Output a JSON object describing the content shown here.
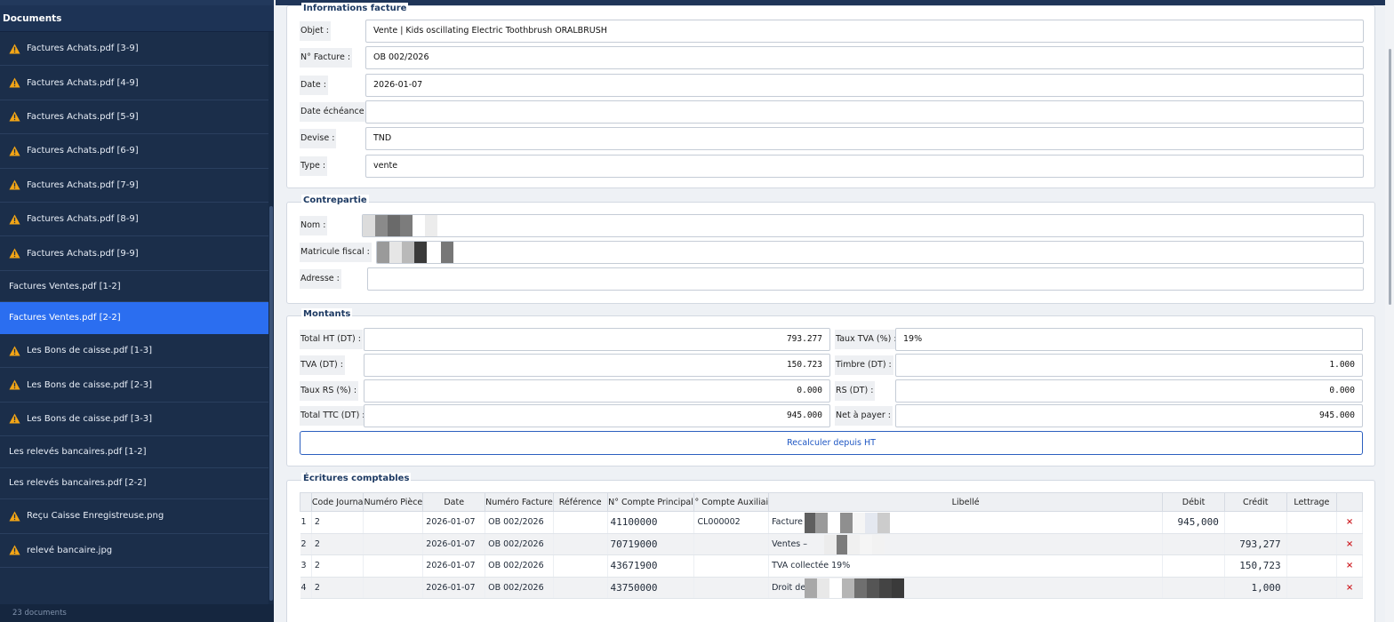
{
  "sidebar": {
    "title": "Documents",
    "items": [
      {
        "label": "Factures Achats.pdf [3-9]",
        "warning": true
      },
      {
        "label": "Factures Achats.pdf [4-9]",
        "warning": true
      },
      {
        "label": "Factures Achats.pdf [5-9]",
        "warning": true
      },
      {
        "label": "Factures Achats.pdf [6-9]",
        "warning": true
      },
      {
        "label": "Factures Achats.pdf [7-9]",
        "warning": true
      },
      {
        "label": "Factures Achats.pdf [8-9]",
        "warning": true
      },
      {
        "label": "Factures Achats.pdf [9-9]",
        "warning": true
      },
      {
        "label": "Factures Ventes.pdf [1-2]",
        "warning": false
      },
      {
        "label": "Factures Ventes.pdf [2-2]",
        "warning": false,
        "selected": true
      },
      {
        "label": "Les Bons de caisse.pdf [1-3]",
        "warning": true
      },
      {
        "label": "Les Bons de caisse.pdf [2-3]",
        "warning": true
      },
      {
        "label": "Les Bons de caisse.pdf [3-3]",
        "warning": true
      },
      {
        "label": "Les relevés bancaires.pdf [1-2]",
        "warning": false
      },
      {
        "label": "Les relevés bancaires.pdf [2-2]",
        "warning": false
      },
      {
        "label": "Reçu Caisse Enregistreuse.png",
        "warning": true
      },
      {
        "label": "relevé bancaire.jpg",
        "warning": true
      }
    ],
    "footer": "23 documents"
  },
  "invoice": {
    "title": "Informations facture",
    "objet_label": "Objet :",
    "objet_value": "Vente | Kids oscillating Electric Toothbrush ORALBRUSH",
    "numero_label": "N° Facture :",
    "numero_value": "OB 002/2026",
    "date_label": "Date :",
    "date_value": "2026-01-07",
    "echeance_label": "Date échéance :",
    "echeance_value": "",
    "devise_label": "Devise :",
    "devise_value": "TND",
    "type_label": "Type :",
    "type_value": "vente"
  },
  "counterparty": {
    "title": "Contrepartie",
    "nom_label": "Nom :",
    "matricule_label": "Matricule fiscal :",
    "adresse_label": "Adresse :",
    "adresse_value": ""
  },
  "amounts": {
    "title": "Montants",
    "total_ht_label": "Total HT (DT) :",
    "total_ht_value": "793.277",
    "taux_tva_label": "Taux TVA (%) :",
    "taux_tva_value": "19%",
    "tva_label": "TVA (DT) :",
    "tva_value": "150.723",
    "timbre_label": "Timbre (DT) :",
    "timbre_value": "1.000",
    "taux_rs_label": "Taux RS (%) :",
    "taux_rs_value": "0.000",
    "rs_label": "RS (DT) :",
    "rs_value": "0.000",
    "total_ttc_label": "Total TTC (DT) :",
    "total_ttc_value": "945.000",
    "net_label": "Net à payer :",
    "net_value": "945.000",
    "recalc_button": "Recalculer depuis HT"
  },
  "entries": {
    "title": "Écritures comptables",
    "columns": [
      "",
      "Code Journa",
      "Numéro Pièce",
      "Date",
      "Numéro Facture",
      "Référence",
      "N° Compte Principal",
      "° Compte Auxiliai",
      "Libellé",
      "Débit",
      "Crédit",
      "Lettrage",
      ""
    ],
    "rows": [
      {
        "idx": "1",
        "journal": "2",
        "piece": "",
        "date": "2026-01-07",
        "facture": "OB 002/2026",
        "ref": "",
        "compte": "41100000",
        "aux": "CL000002",
        "libelle": "Facture",
        "debit": "945,000",
        "credit": "",
        "lettrage": "",
        "delete": "×"
      },
      {
        "idx": "2",
        "journal": "2",
        "piece": "",
        "date": "2026-01-07",
        "facture": "OB 002/2026",
        "ref": "",
        "compte": "70719000",
        "aux": "",
        "libelle": "Ventes –",
        "debit": "",
        "credit": "793,277",
        "lettrage": "",
        "delete": "×"
      },
      {
        "idx": "3",
        "journal": "2",
        "piece": "",
        "date": "2026-01-07",
        "facture": "OB 002/2026",
        "ref": "",
        "compte": "43671900",
        "aux": "",
        "libelle": "TVA collectée 19%",
        "debit": "",
        "credit": "150,723",
        "lettrage": "",
        "delete": "×"
      },
      {
        "idx": "4",
        "journal": "2",
        "piece": "",
        "date": "2026-01-07",
        "facture": "OB 002/2026",
        "ref": "",
        "compte": "43750000",
        "aux": "",
        "libelle": "Droit de",
        "debit": "",
        "credit": "1,000",
        "lettrage": "",
        "delete": "×"
      }
    ]
  },
  "colors": {
    "sidebar_bg": "#1b2e4a",
    "selected_bg": "#2b6ef0",
    "accent": "#1f57c3",
    "warning": "#f2a516",
    "delete": "#d0262b"
  }
}
